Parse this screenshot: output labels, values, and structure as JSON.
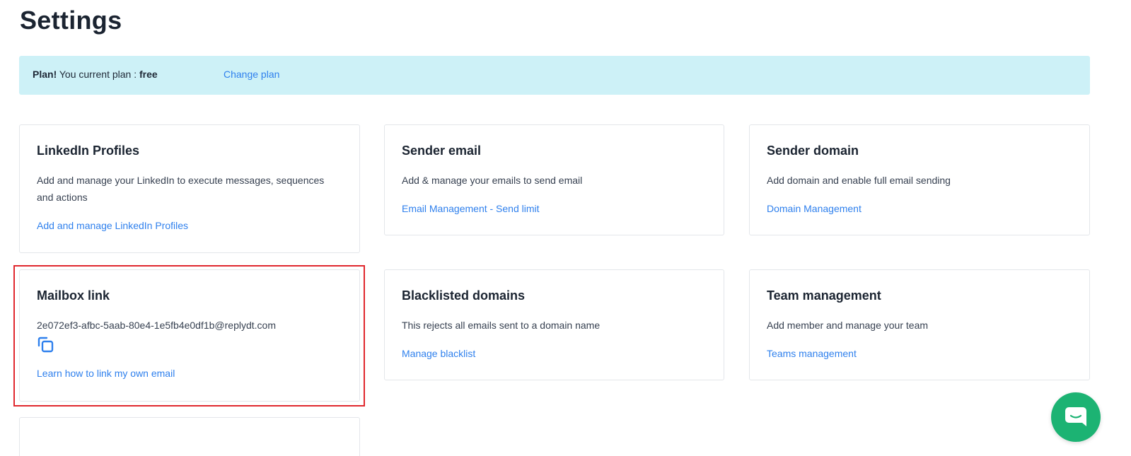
{
  "page": {
    "title": "Settings"
  },
  "plan": {
    "label": "Plan!",
    "text": "You current plan :",
    "value": "free",
    "change_link": "Change plan"
  },
  "cards": [
    {
      "title": "LinkedIn Profiles",
      "description": "Add and manage your LinkedIn to execute messages, sequences and actions",
      "link": "Add and manage LinkedIn Profiles"
    },
    {
      "title": "Sender email",
      "description": "Add & manage your emails to send email",
      "link": "Email Management - Send limit"
    },
    {
      "title": "Sender domain",
      "description": "Add domain and enable full email sending",
      "link": "Domain Management"
    },
    {
      "title": "Mailbox link",
      "description": "2e072ef3-afbc-5aab-80e4-1e5fb4e0df1b@replydt.com",
      "link": "Learn how to link my own email",
      "icon": "copy-icon"
    },
    {
      "title": "Blacklisted domains",
      "description": "This rejects all emails sent to a domain name",
      "link": "Manage blacklist"
    },
    {
      "title": "Team management",
      "description": "Add member and manage your team",
      "link": "Teams management"
    }
  ],
  "chat": {
    "icon": "chat-bubble-icon"
  },
  "colors": {
    "accent": "#2f80ed",
    "banner": "#cdf1f7",
    "highlight": "#e0282e",
    "chat": "#1cb373"
  }
}
